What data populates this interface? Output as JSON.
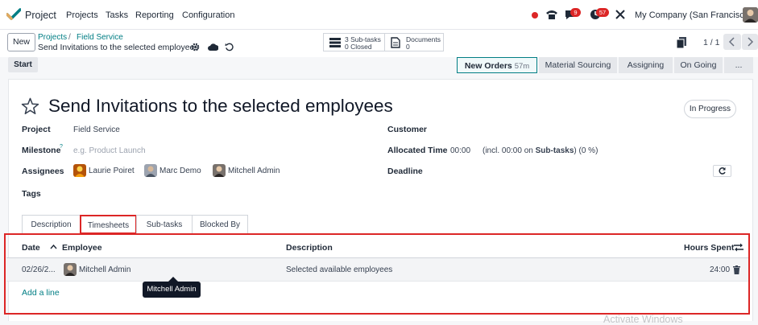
{
  "topbar": {
    "app_name": "Project",
    "menu": [
      "Projects",
      "Tasks",
      "Reporting",
      "Configuration"
    ],
    "messages_count": "9",
    "activities_count": "57",
    "company": "My Company (San Francisco)"
  },
  "control": {
    "new_label": "New",
    "breadcrumb_projects": "Projects",
    "breadcrumb_separator": "/",
    "breadcrumb_project": "Field Service",
    "record_title": "Send Invitations to the selected employees",
    "subtasks_line1": "3 Sub-tasks",
    "subtasks_line2": "0 Closed",
    "documents_line1": "Documents",
    "documents_line2": "0",
    "pager": "1 / 1"
  },
  "statusbar": {
    "start_label": "Start",
    "stages": [
      {
        "label": "New Orders",
        "duration": "57m"
      },
      {
        "label": "Material Sourcing"
      },
      {
        "label": "Assigning"
      },
      {
        "label": "On Going"
      },
      {
        "label": "..."
      }
    ]
  },
  "form": {
    "title": "Send Invitations to the selected employees",
    "state": "In Progress",
    "project_label": "Project",
    "project_value": "Field Service",
    "milestone_label": "Milestone",
    "milestone_tooltip_mark": "?",
    "milestone_placeholder": "e.g. Product Launch",
    "assignees_label": "Assignees",
    "assignees": [
      "Laurie Poiret",
      "Marc Demo",
      "Mitchell Admin"
    ],
    "tags_label": "Tags",
    "customer_label": "Customer",
    "allocated_label": "Allocated Time",
    "allocated_value": "00:00",
    "allocated_note_prefix": "(incl. 00:00 on",
    "allocated_note_bold": "Sub-tasks",
    "allocated_note_suffix": ") (0 %)",
    "deadline_label": "Deadline"
  },
  "tabs": [
    "Description",
    "Timesheets",
    "Sub-tasks",
    "Blocked By"
  ],
  "timesheets": {
    "columns": {
      "date": "Date",
      "employee": "Employee",
      "description": "Description",
      "hours": "Hours Spent"
    },
    "rows": [
      {
        "date": "02/26/2...",
        "employee": "Mitchell Admin",
        "description": "Selected available employees",
        "hours": "24:00"
      }
    ],
    "add_line": "Add a line",
    "tooltip": "Mitchell Admin"
  },
  "watermark": "Activate Windows",
  "colors": {
    "accent": "#017e84",
    "highlight": "#dc2626",
    "logo": "#017e84"
  }
}
